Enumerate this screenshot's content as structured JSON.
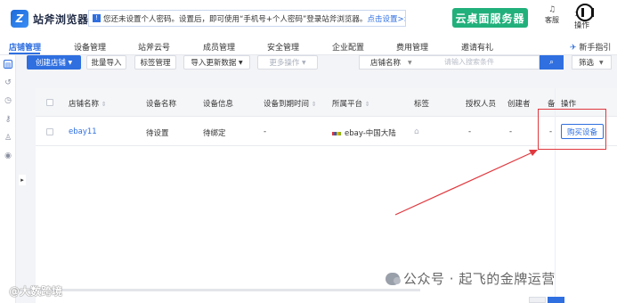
{
  "app": {
    "logo_mark": "Z",
    "logo_text": "站斧浏览器"
  },
  "notice": {
    "text": "您还未设置个人密码。设置后，即可使用“手机号+个人密码”登录站斧浏览器。",
    "link": "点击设置>>"
  },
  "header": {
    "cloud_button": "云桌面服务器",
    "service_label": "客服",
    "avatar_label": "操作",
    "avatar_num": "1"
  },
  "nav": {
    "items": [
      "店铺管理",
      "设备管理",
      "站斧云号",
      "成员管理",
      "安全管理",
      "企业配置",
      "费用管理",
      "邀请有礼"
    ],
    "guide": "新手指引"
  },
  "toolbar": {
    "create_shop": "创建店铺",
    "batch_import": "批量导入",
    "tag_manage": "标签管理",
    "import_update": "导入更新数据",
    "more_ops": "更多操作",
    "search_field": "店铺名称",
    "search_placeholder": "请输入搜索条件",
    "filter": "筛选"
  },
  "table": {
    "columns": [
      "店铺名称",
      "设备名称",
      "设备信息",
      "设备到期时间",
      "所属平台",
      "标签",
      "授权人员",
      "创建者",
      "备",
      "操作"
    ],
    "rows": [
      {
        "shop_name": "ebay11",
        "device_name": "待设置",
        "device_info": "待绑定",
        "expire": "-",
        "platform": "ebay-中国大陆",
        "authorized": "-",
        "creator": "-",
        "remark": "-",
        "action": "购买设备"
      }
    ]
  },
  "watermark": {
    "text": "公众号 · 起飞的金牌运营",
    "text2": "@大数跨境"
  },
  "colors": {
    "primary": "#2f6fe0",
    "cloud_green": "#21b07c",
    "annotation_red": "#e0383e"
  }
}
